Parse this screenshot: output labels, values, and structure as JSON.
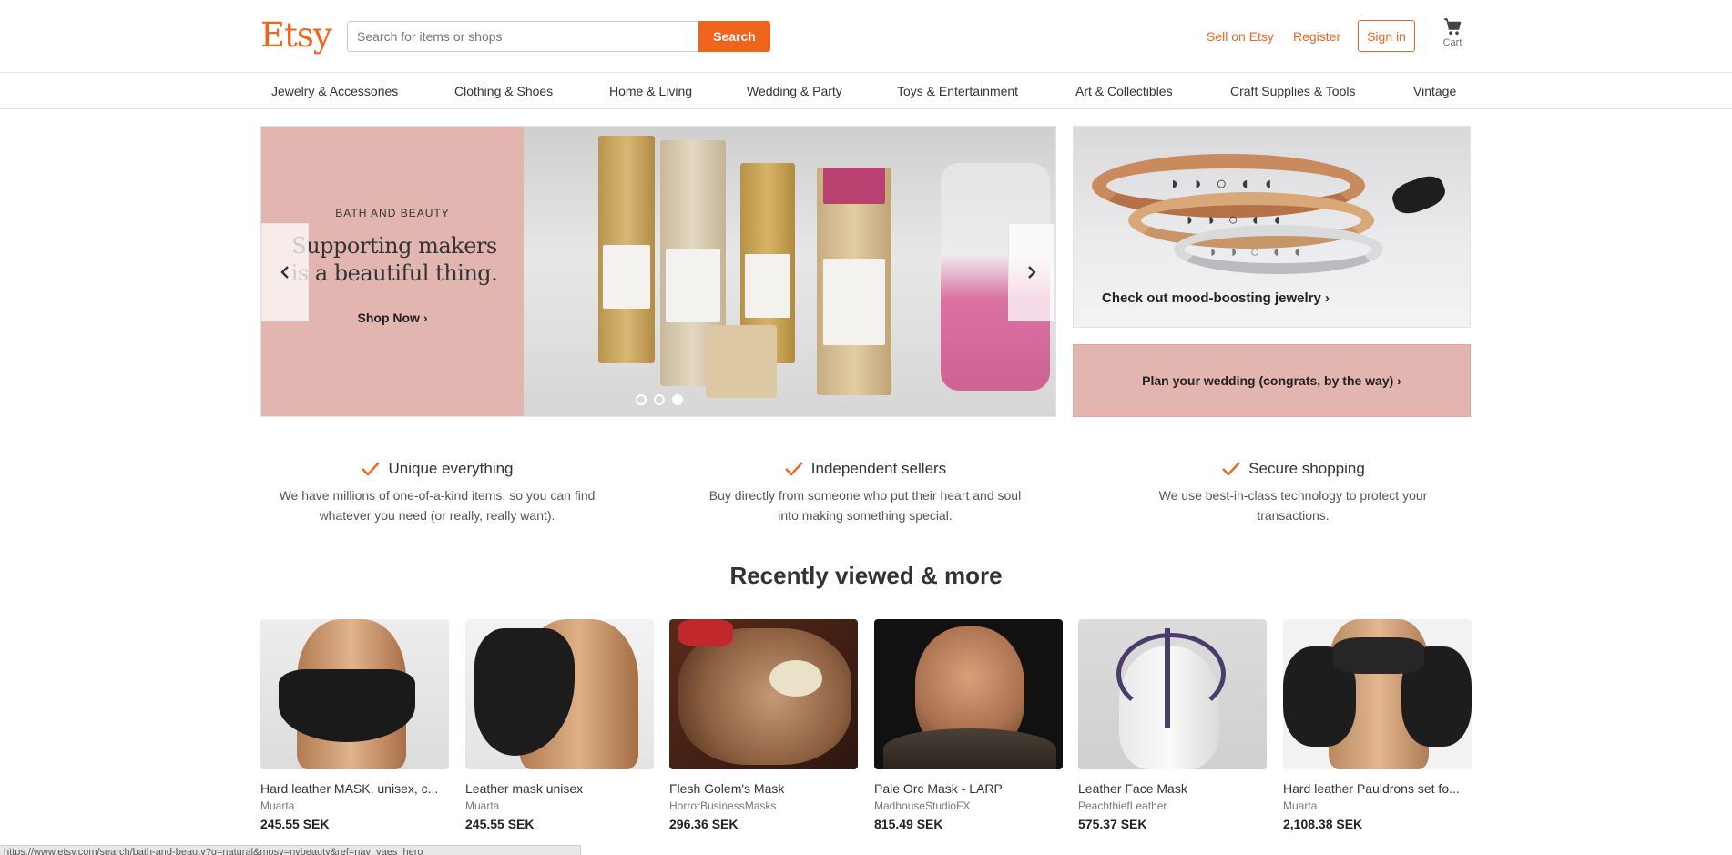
{
  "header": {
    "logo": "Etsy",
    "search": {
      "placeholder": "Search for items or shops",
      "button_label": "Search"
    },
    "sell_link": "Sell on Etsy",
    "register_link": "Register",
    "signin_label": "Sign in",
    "cart_label": "Cart",
    "accent_color": "#f1641e"
  },
  "categories": [
    "Jewelry & Accessories",
    "Clothing & Shoes",
    "Home & Living",
    "Wedding & Party",
    "Toys & Entertainment",
    "Art & Collectibles",
    "Craft Supplies & Tools",
    "Vintage"
  ],
  "hero": {
    "eyebrow": "BATH AND BEAUTY",
    "title": "Supporting makers is a beautiful thing.",
    "cta": "Shop Now ›",
    "slide_count": 3,
    "active_slide": 3,
    "prev_icon": "chevron-left-icon",
    "next_icon": "chevron-right-icon",
    "panel_color": "#e3b5b0"
  },
  "promos": {
    "jewelry": "Check out mood-boosting jewelry ›",
    "wedding": "Plan your wedding (congrats, by the way) ›"
  },
  "value_props": [
    {
      "title": "Unique everything",
      "desc": "We have millions of one-of-a-kind items, so you can find whatever you need (or really, really want)."
    },
    {
      "title": "Independent sellers",
      "desc": "Buy directly from someone who put their heart and soul into making something special."
    },
    {
      "title": "Secure shopping",
      "desc": "We use best-in-class technology to protect your transactions."
    }
  ],
  "recently_viewed": {
    "title": "Recently viewed & more",
    "items": [
      {
        "title": "Hard leather MASK, unisex, c...",
        "shop": "Muarta",
        "price": "245.55 SEK"
      },
      {
        "title": "Leather mask unisex",
        "shop": "Muarta",
        "price": "245.55 SEK"
      },
      {
        "title": "Flesh Golem's Mask",
        "shop": "HorrorBusinessMasks",
        "price": "296.36 SEK"
      },
      {
        "title": "Pale Orc Mask - LARP",
        "shop": "MadhouseStudioFX",
        "price": "815.49 SEK"
      },
      {
        "title": "Leather Face Mask",
        "shop": "PeachthiefLeather",
        "price": "575.37 SEK"
      },
      {
        "title": "Hard leather Pauldrons set fo...",
        "shop": "Muarta",
        "price": "2,108.38 SEK"
      }
    ]
  },
  "status_bar": "https://www.etsy.com/search/bath-and-beauty?q=natural&mosv=nybeauty&ref=nav_vaes_hero"
}
